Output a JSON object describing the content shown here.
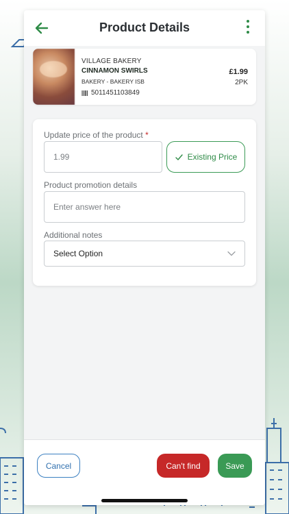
{
  "header": {
    "title": "Product Details",
    "back_icon": "arrow-left-icon",
    "menu_icon": "more-vertical-icon"
  },
  "product": {
    "brand": "VILLAGE BAKERY",
    "name": "CINNAMON SWIRLS",
    "category": "BAKERY - BAKERY ISB",
    "barcode": "5011451103849",
    "barcode_icon": "barcode-icon",
    "price": "£1.99",
    "pack": "2PK"
  },
  "form": {
    "price_label": "Update price of the product",
    "price_required": "*",
    "price_value": "1.99",
    "existing_price_label": "Existing Price",
    "existing_price_icon": "check-icon",
    "promotion_label": "Product promotion details",
    "promotion_placeholder": "Enter answer here",
    "notes_label": "Additional notes",
    "notes_selected": "Select Option",
    "notes_icon": "chevron-down-icon"
  },
  "footer": {
    "cancel_label": "Cancel",
    "cant_find_label": "Can't find",
    "save_label": "Save"
  },
  "colors": {
    "accent_green": "#3a9a55",
    "danger_red": "#c62828",
    "link_blue": "#2f6fae"
  }
}
